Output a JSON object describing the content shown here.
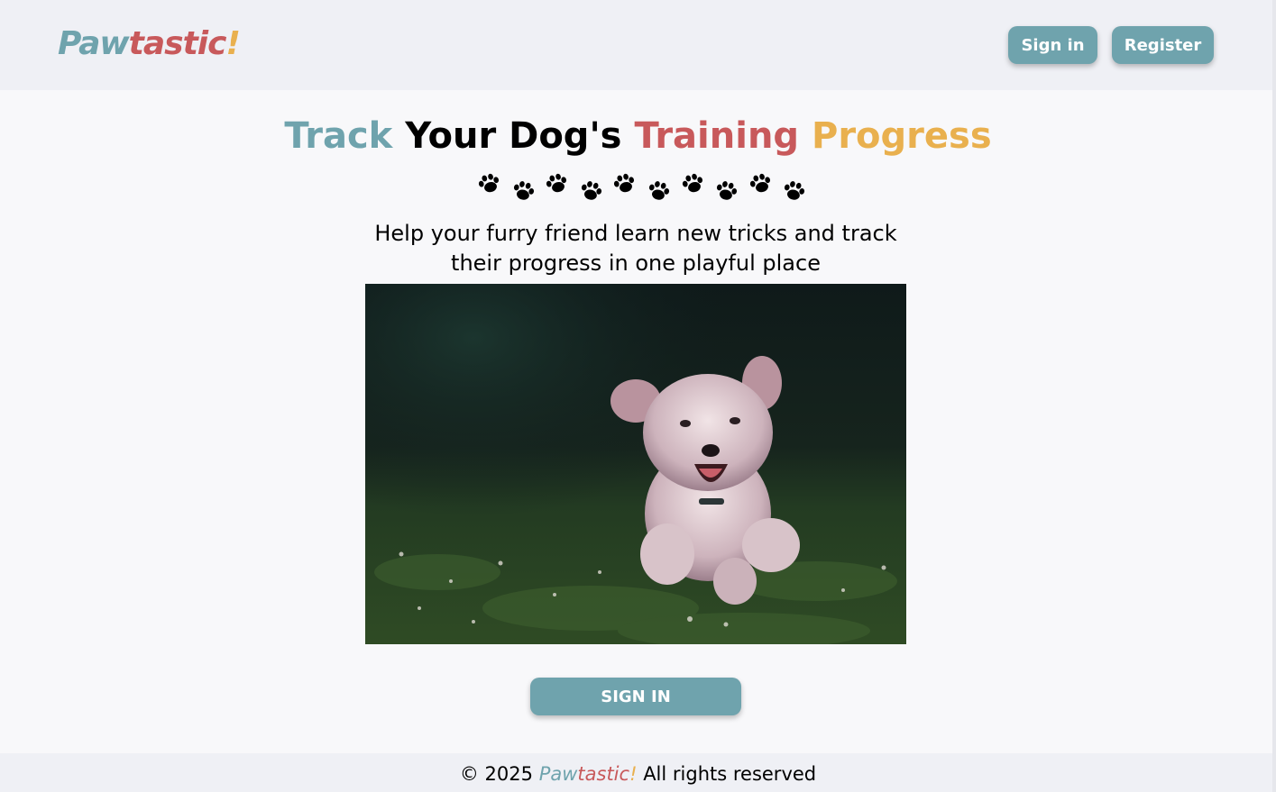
{
  "header": {
    "logo": {
      "part1": "Paw",
      "part2": "tastic",
      "part3": "!"
    },
    "signin_label": "Sign in",
    "register_label": "Register"
  },
  "hero": {
    "title_word1": "Track",
    "title_word2": "Your Dog's",
    "title_word3": "Training",
    "title_word4": "Progress",
    "subtitle_line1": "Help your furry friend learn new tricks and track",
    "subtitle_line2": "their progress in one playful place",
    "paw_count": 10,
    "paw_icon": "paw-print-icon",
    "cta_label": "SIGN IN"
  },
  "footer": {
    "copyright": "© 2025",
    "brand_part1": "Paw",
    "brand_part2": "tastic",
    "brand_part3": "!",
    "rights": "All rights reserved"
  },
  "colors": {
    "teal": "#6fa3ad",
    "red": "#c8595b",
    "gold": "#e9b04e",
    "header_bg": "#eff0f5",
    "page_bg": "#f8f8fa"
  }
}
